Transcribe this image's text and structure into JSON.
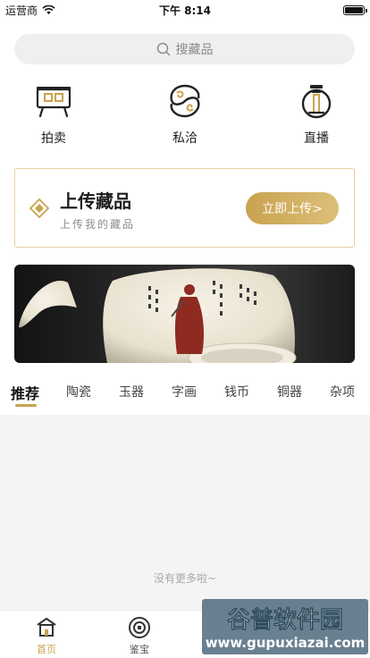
{
  "status_bar": {
    "carrier": "运营商",
    "time": "下午 8:14"
  },
  "search": {
    "placeholder": "搜藏品"
  },
  "features": [
    {
      "label": "拍卖",
      "icon": "auction-icon"
    },
    {
      "label": "私洽",
      "icon": "negotiation-icon"
    },
    {
      "label": "直播",
      "icon": "live-icon"
    }
  ],
  "upload_card": {
    "title": "上传藏品",
    "subtitle": "上传我的藏品",
    "button": "立即上传>"
  },
  "tabs": [
    "推荐",
    "陶瓷",
    "玉器",
    "字画",
    "钱币",
    "铜器",
    "杂项"
  ],
  "active_tab": "推荐",
  "content": {
    "no_more": "没有更多啦~"
  },
  "bottom_nav": [
    {
      "label": "首页",
      "icon": "home-icon",
      "active": true
    },
    {
      "label": "鉴宝",
      "icon": "appraisal-icon",
      "active": false
    }
  ],
  "watermark": {
    "brand": "谷普软件园",
    "url": "www.gupuxiazai.com"
  },
  "colors": {
    "accent": "#c9a24f",
    "card_border": "#e8cfa0",
    "search_bg": "#efefef",
    "content_bg": "#f4f4f4"
  }
}
